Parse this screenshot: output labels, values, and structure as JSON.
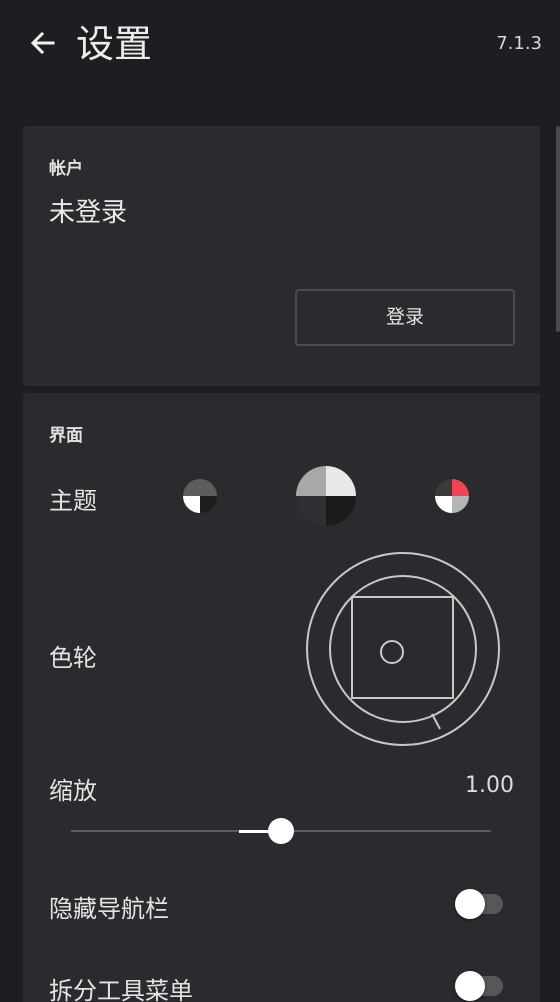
{
  "header": {
    "title": "设置",
    "version": "7.1.3",
    "back_icon": "arrow-left-icon"
  },
  "account": {
    "section_title": "帐户",
    "status": "未登录",
    "login_label": "登录"
  },
  "interface": {
    "section_title": "界面",
    "theme": {
      "label": "主题",
      "options": [
        {
          "name": "dark-theme",
          "colors": [
            "#5c5c5c",
            "#ffffff",
            "#1e1e1e"
          ]
        },
        {
          "name": "gray-theme",
          "colors": [
            "#a8a8a8",
            "#e8e8e8",
            "#1b1b1d",
            "#2f3033"
          ],
          "selected": true
        },
        {
          "name": "light-red-theme",
          "colors": [
            "#3a3a3a",
            "#f04456",
            "#ffffff",
            "#b5b5b5"
          ]
        }
      ]
    },
    "color_wheel": {
      "label": "色轮"
    },
    "zoom": {
      "label": "缩放",
      "value": "1.00",
      "level": 0.5
    },
    "hide_navbar": {
      "label": "隐藏导航栏",
      "on": false
    },
    "split_toolbar": {
      "label": "拆分工具菜单",
      "on": false
    }
  },
  "colors": {
    "background": "#1d1e21",
    "card": "#2a2b2e",
    "text": "#e6e6e6",
    "accent_red": "#f04456"
  }
}
